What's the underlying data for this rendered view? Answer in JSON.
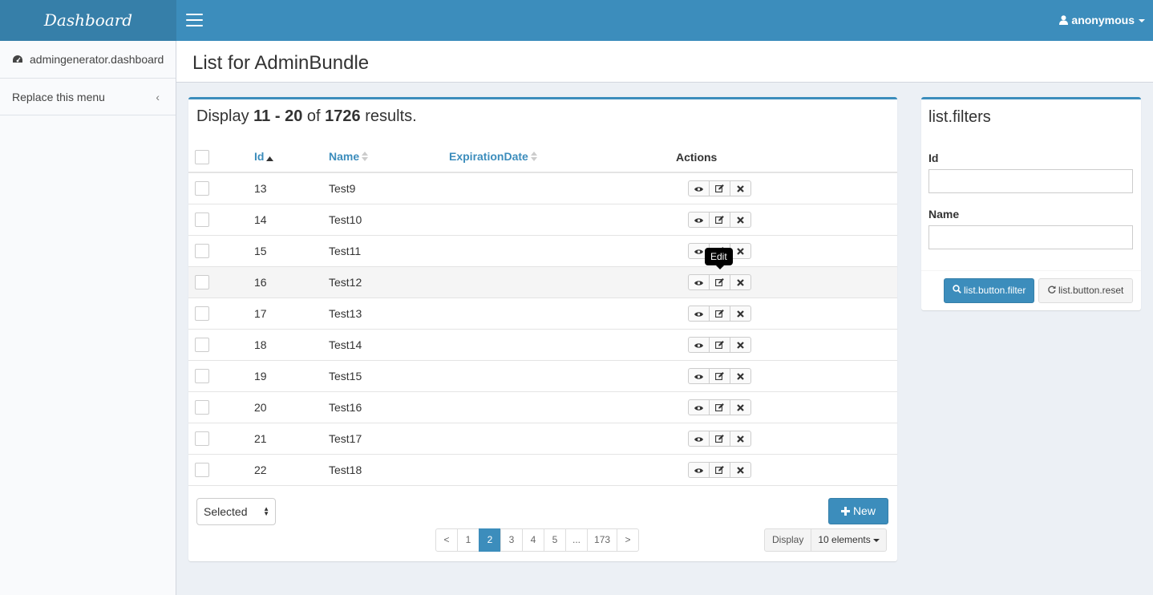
{
  "header": {
    "logo": "Dashboard",
    "user": "anonymous"
  },
  "sidebar": {
    "items": [
      {
        "label": "admingenerator.dashboard",
        "icon": "dashboard-icon"
      },
      {
        "label": "Replace this menu",
        "icon": "chevron-left-icon"
      }
    ]
  },
  "page": {
    "title": "List for AdminBundle"
  },
  "summary": {
    "prefix": "Display",
    "from": "11",
    "sep": "-",
    "to": "20",
    "of": "of",
    "total": "1726",
    "suffix": "results."
  },
  "table": {
    "columns": {
      "id": "Id",
      "name": "Name",
      "expiration": "ExpirationDate",
      "actions": "Actions"
    },
    "rows": [
      {
        "id": "13",
        "name": "Test9",
        "expiration": ""
      },
      {
        "id": "14",
        "name": "Test10",
        "expiration": ""
      },
      {
        "id": "15",
        "name": "Test11",
        "expiration": ""
      },
      {
        "id": "16",
        "name": "Test12",
        "expiration": ""
      },
      {
        "id": "17",
        "name": "Test13",
        "expiration": ""
      },
      {
        "id": "18",
        "name": "Test14",
        "expiration": ""
      },
      {
        "id": "19",
        "name": "Test15",
        "expiration": ""
      },
      {
        "id": "20",
        "name": "Test16",
        "expiration": ""
      },
      {
        "id": "21",
        "name": "Test17",
        "expiration": ""
      },
      {
        "id": "22",
        "name": "Test18",
        "expiration": ""
      }
    ],
    "highlighted_row": 3,
    "tooltip": "Edit"
  },
  "batch": {
    "selected": "Selected"
  },
  "buttons": {
    "new": "New"
  },
  "pagination": {
    "prev": "<",
    "pages": [
      "1",
      "2",
      "3",
      "4",
      "5",
      "...",
      "173"
    ],
    "active": "2",
    "next": ">"
  },
  "display": {
    "label": "Display",
    "value": "10 elements"
  },
  "filters": {
    "title": "list.filters",
    "id_label": "Id",
    "id_value": "",
    "name_label": "Name",
    "name_value": "",
    "filter_button": "list.button.filter",
    "reset_button": "list.button.reset"
  },
  "colors": {
    "primary": "#3c8dbc",
    "primary_dark": "#367fa9",
    "sidebar_bg": "#f9fafc",
    "body_bg": "#ecf0f5"
  }
}
